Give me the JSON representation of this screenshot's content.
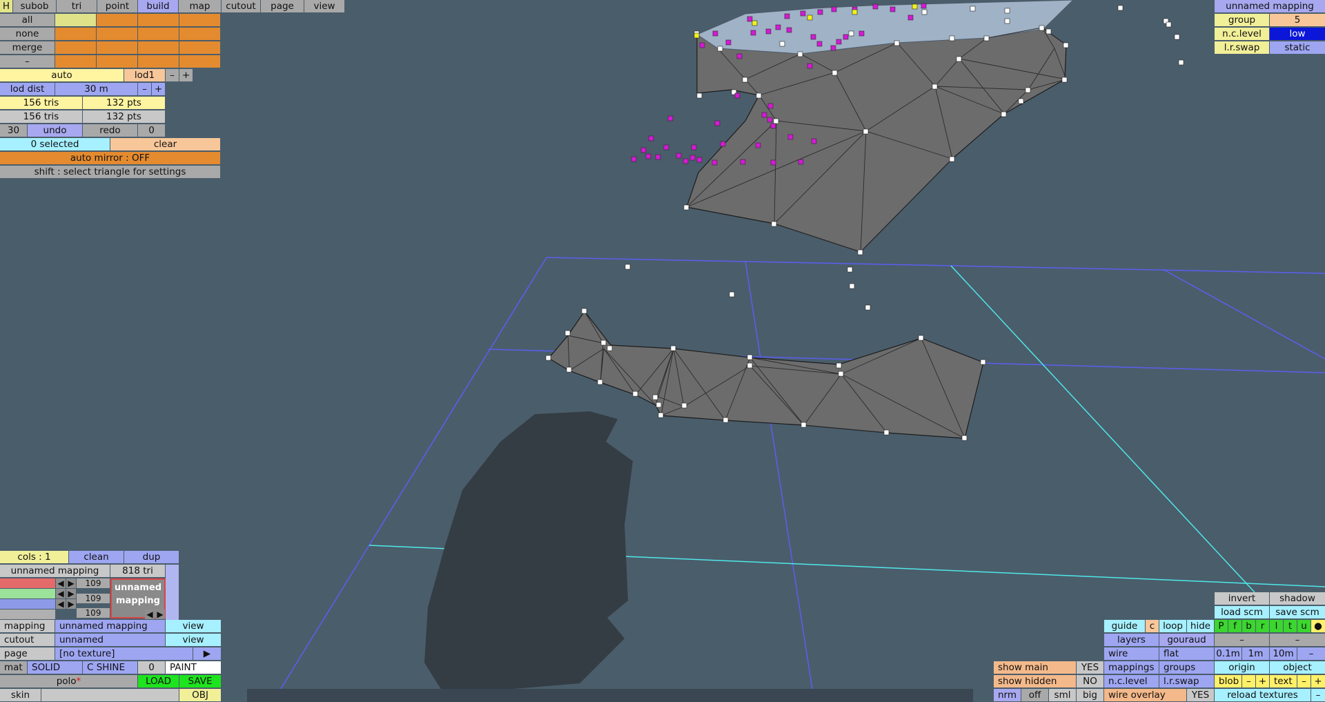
{
  "menu": {
    "items": [
      "H",
      "subob",
      "tri",
      "point",
      "build",
      "map",
      "cutout",
      "page",
      "view"
    ],
    "active": "build"
  },
  "select_panel": {
    "all": "all",
    "none": "none",
    "merge": "merge",
    "dash": "–"
  },
  "lod": {
    "auto": "auto",
    "level": "lod1",
    "minus": "–",
    "plus": "+",
    "dist_label": "lod dist",
    "dist_value": "30 m"
  },
  "stats": {
    "tris1": "156 tris",
    "pts1": "132 pts",
    "tris2": "156 tris",
    "pts2": "132 pts"
  },
  "history": {
    "count": "30",
    "undo": "undo",
    "redo": "redo",
    "redo_count": "0"
  },
  "selection": {
    "selected": "0 selected",
    "clear": "clear",
    "auto_mirror": "auto mirror : OFF",
    "hint": "shift : select triangle for settings"
  },
  "top_right": {
    "mapping_name": "unnamed mapping",
    "group_label": "group",
    "group_value": "5",
    "ncl_label": "n.c.level",
    "ncl_value": "low",
    "lrswap_label": "l.r.swap",
    "lrswap_value": "static"
  },
  "mapping_panel": {
    "cols": "cols : 1",
    "clean": "clean",
    "dup": "dup",
    "mapping_name": "unnamed mapping",
    "tri_count": "818 tri",
    "r": "109",
    "g": "109",
    "b": "109",
    "thumb_line1": "unnamed",
    "thumb_line2": "mapping"
  },
  "bottom_left": {
    "mapping_label": "mapping",
    "mapping_value": "unnamed mapping",
    "view1": "view",
    "cutout_label": "cutout",
    "cutout_value": "unnamed",
    "view2": "view",
    "page_label": "page",
    "page_value": "[no texture]",
    "page_arrow": "▶",
    "mat": "mat",
    "solid": "SOLID",
    "cshine": "C SHINE",
    "num": "0",
    "paint": "PAINT",
    "object_name": "polo",
    "dirty_mark": "*",
    "load": "LOAD",
    "save": "SAVE",
    "skin": "skin",
    "obj": "OBJ"
  },
  "bottom_right": {
    "invert": "invert",
    "shadow": "shadow",
    "load_scm": "load scm",
    "save_scm": "save scm",
    "guide": "guide",
    "c": "c",
    "loop": "loop",
    "hide": "hide",
    "axes": [
      "P",
      "f",
      "b",
      "r",
      "l",
      "t",
      "u"
    ],
    "dot": "●",
    "layers": "layers",
    "gouraud": "gouraud",
    "dash1": "–",
    "dash2": "–",
    "wire": "wire",
    "flat": "flat",
    "g01": "0.1m",
    "g1": "1m",
    "g10": "10m",
    "gminus": "–",
    "show_main": "show main",
    "show_main_val": "YES",
    "mappings": "mappings",
    "groups": "groups",
    "origin": "origin",
    "object": "object",
    "show_hidden": "show hidden",
    "show_hidden_val": "NO",
    "ncl": "n.c.level",
    "lrswap": "l.r.swap",
    "blob": "blob",
    "bminus": "–",
    "bplus": "+",
    "text": "text",
    "tminus": "–",
    "tplus": "+",
    "nrm": "nrm",
    "off": "off",
    "sml": "sml",
    "big": "big",
    "wire_overlay": "wire overlay",
    "wire_overlay_val": "YES",
    "reload": "reload textures",
    "rminus": "–"
  }
}
